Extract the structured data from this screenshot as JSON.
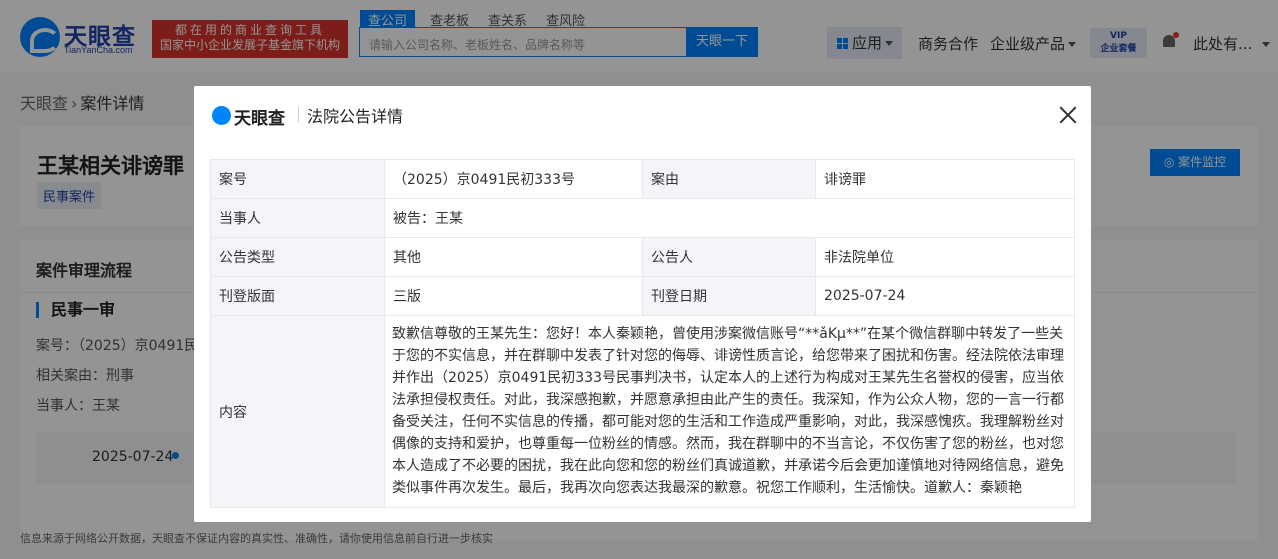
{
  "header": {
    "logo_text": "天眼查",
    "logo_sub": "TianYanCha.com",
    "slogan_line1": "都在用的商业查询工具",
    "slogan_line2": "国家中小企业发展子基金旗下机构",
    "search_tabs": [
      "查公司",
      "查老板",
      "查关系",
      "查风险"
    ],
    "search_placeholder": "请输入公司名称、老板姓名、品牌名称等",
    "search_button": "天眼一下",
    "nav_app": "应用",
    "nav_business": "商务合作",
    "nav_enterprise": "企业级产品",
    "vip_line1": "VIP",
    "vip_line2": "企业套餐",
    "user_name": "此处有..."
  },
  "breadcrumb": {
    "home": "天眼查",
    "current": "案件详情"
  },
  "case": {
    "title": "王某相关诽谤罪",
    "tag": "民事案件",
    "monitor_button": "案件监控"
  },
  "flow": {
    "title": "案件审理流程",
    "trial": "民事一审",
    "case_no": "案号：（2025）京0491民",
    "related_cause": "相关案由：刑事",
    "party": "当事人：王某",
    "date": "2025-07-24"
  },
  "footer_note": "信息来源于网络公开数据，天眼查不保证内容的真实性、准确性，请你使用信息前自行进一步核实",
  "modal": {
    "logo": "天眼查",
    "title": "法院公告详情",
    "rows": {
      "case_no_label": "案号",
      "case_no_value": "（2025）京0491民初333号",
      "cause_label": "案由",
      "cause_value": "诽谤罪",
      "party_label": "当事人",
      "party_value": "被告：王某",
      "type_label": "公告类型",
      "type_value": "其他",
      "announcer_label": "公告人",
      "announcer_value": "非法院单位",
      "page_label": "刊登版面",
      "page_value": "三版",
      "date_label": "刊登日期",
      "date_value": "2025-07-24",
      "content_label": "内容",
      "content_value": "致歉信尊敬的王某先生：您好！本人秦颖艳，曾使用涉案微信账号“**ǎKμ**”在某个微信群聊中转发了一些关于您的不实信息，并在群聊中发表了针对您的侮辱、诽谤性质言论，给您带来了困扰和伤害。经法院依法审理并作出（2025）京0491民初333号民事判决书，认定本人的上述行为构成对王某先生名誉权的侵害，应当依法承担侵权责任。对此，我深感抱歉，并愿意承担由此产生的责任。我深知，作为公众人物，您的一言一行都备受关注，任何不实信息的传播，都可能对您的生活和工作造成严重影响，对此，我深感愧疚。我理解粉丝对偶像的支持和爱护，也尊重每一位粉丝的情感。然而，我在群聊中的不当言论，不仅伤害了您的粉丝，也对您本人造成了不必要的困扰，我在此向您和您的粉丝们真诚道歉，并承诺今后会更加谨慎地对待网络信息，避免类似事件再次发生。最后，我再次向您表达我最深的歉意。祝您工作顺利，生活愉快。道歉人：秦颖艳"
    }
  }
}
